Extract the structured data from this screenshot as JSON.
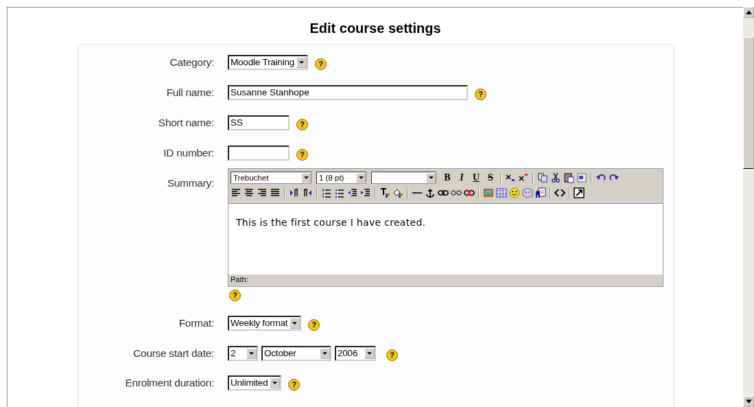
{
  "title": "Edit course settings",
  "fields": [
    {
      "kind": "select",
      "label": "Category:",
      "value": "Moodle Training",
      "help": "?"
    },
    {
      "kind": "wide_text",
      "label": "Full name:",
      "value": "Susanne Stanhope",
      "help": "?"
    },
    {
      "kind": "text",
      "label": "Short name:",
      "value": "SS",
      "help": "?"
    },
    {
      "kind": "text",
      "label": "ID number:",
      "help": "?"
    },
    {
      "kind": "editor",
      "label": "Summary:",
      "help": "?",
      "font": "Trebuchet",
      "font_size": "1 (8 pt)",
      "format_buttons": [
        "B",
        "I",
        "U",
        "S"
      ],
      "content": "This is the first course I have created.",
      "path": "Path:"
    },
    {
      "kind": "select",
      "label": "Format:",
      "value": "Weekly format",
      "help": "?"
    },
    {
      "kind": "date",
      "label": "Course start date:",
      "parts": [
        "2",
        "October",
        "2006"
      ],
      "help": "?"
    },
    {
      "kind": "select",
      "label": "Enrolment duration:",
      "value": "Unlimited",
      "help": "?"
    }
  ]
}
